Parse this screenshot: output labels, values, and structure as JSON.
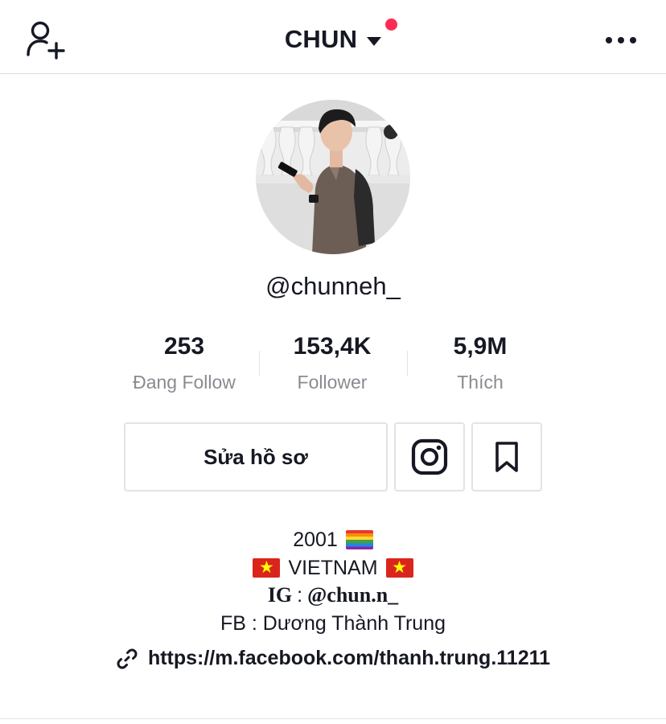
{
  "header": {
    "title": "CHUN",
    "icons": {
      "add_user": "person-add-icon",
      "more": "more-horizontal-icon",
      "caret": "caret-down-icon"
    },
    "notification_dot_color": "#fe2c55"
  },
  "profile": {
    "avatar": "profile-photo",
    "username": "@chunneh_"
  },
  "stats": [
    {
      "value": "253",
      "label": "Đang Follow"
    },
    {
      "value": "153,4K",
      "label": "Follower"
    },
    {
      "value": "5,9M",
      "label": "Thích"
    }
  ],
  "actions": {
    "edit_label": "Sửa hồ sơ",
    "instagram_icon": "instagram-icon",
    "bookmark_icon": "bookmark-icon"
  },
  "bio": {
    "line1": "2001",
    "line2": "VIETNAM",
    "ig_prefix": "IG",
    "ig_sep": ":",
    "ig_handle": "@chun.n_",
    "fb": "FB : Dương Thành Trung"
  },
  "link": {
    "icon": "link-icon",
    "url": "https://m.facebook.com/thanh.trung.11211"
  },
  "colors": {
    "text": "#161823",
    "secondary": "#8a8b91",
    "accent": "#fe2c55",
    "border": "#e3e3e4"
  }
}
